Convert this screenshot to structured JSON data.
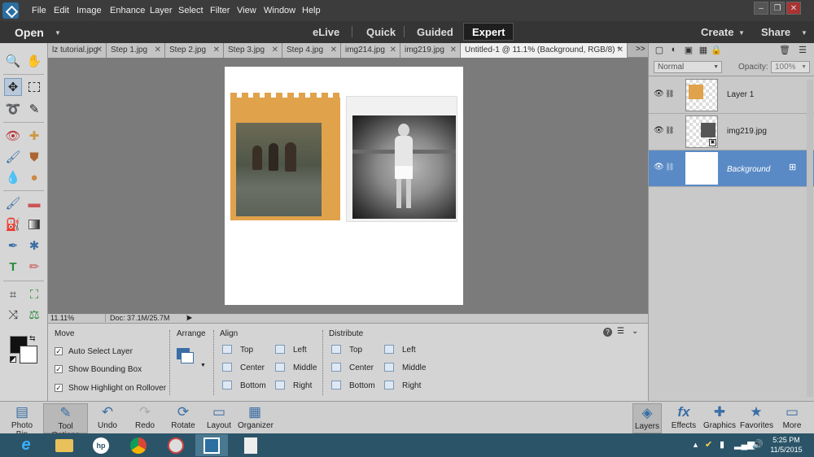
{
  "menu": [
    "File",
    "Edit",
    "Image",
    "Enhance",
    "Layer",
    "Select",
    "Filter",
    "View",
    "Window",
    "Help"
  ],
  "modebar": {
    "open": "Open",
    "modes": [
      "eLive",
      "Quick",
      "Guided",
      "Expert"
    ],
    "active": "Expert",
    "create": "Create",
    "share": "Share"
  },
  "tabs": [
    {
      "label": "lz tutorial.jpg"
    },
    {
      "label": "Step 1.jpg"
    },
    {
      "label": "Step 2.jpg"
    },
    {
      "label": "Step 3.jpg"
    },
    {
      "label": "Step 4.jpg"
    },
    {
      "label": "img214.jpg"
    },
    {
      "label": "img219.jpg"
    },
    {
      "label": "Untitled-1 @ 11.1% (Background, RGB/8) *"
    }
  ],
  "tab_overflow": ">>",
  "status": {
    "zoom": "11.11%",
    "doc": "Doc: 37.1M/25.7M"
  },
  "options": {
    "move_title": "Move",
    "checks": [
      {
        "label": "Auto Select Layer"
      },
      {
        "label": "Show Bounding Box"
      },
      {
        "label": "Show Highlight on Rollover"
      }
    ],
    "arrange_title": "Arrange",
    "align_title": "Align",
    "align": [
      "Top",
      "Center",
      "Bottom",
      "Left",
      "Middle",
      "Right"
    ],
    "distribute_title": "Distribute",
    "distribute": [
      "Top",
      "Center",
      "Bottom",
      "Left",
      "Middle",
      "Right"
    ]
  },
  "panel": {
    "blend_mode": "Normal",
    "opacity_label": "Opacity:",
    "opacity_value": "100%",
    "layers": [
      {
        "name": "Layer 1",
        "selected": false
      },
      {
        "name": "img219.jpg",
        "selected": false
      },
      {
        "name": "Background",
        "selected": true
      }
    ]
  },
  "bottombar": {
    "left": [
      "Photo Bin",
      "Tool Options",
      "Undo",
      "Redo",
      "Rotate",
      "Layout",
      "Organizer"
    ],
    "right": [
      "Layers",
      "Effects",
      "Graphics",
      "Favorites",
      "More"
    ]
  },
  "taskbar": {
    "time": "5:25 PM",
    "date": "11/5/2015"
  },
  "colors": {
    "accent": "#3a6ea5",
    "selected_layer": "#5a8ac6"
  }
}
